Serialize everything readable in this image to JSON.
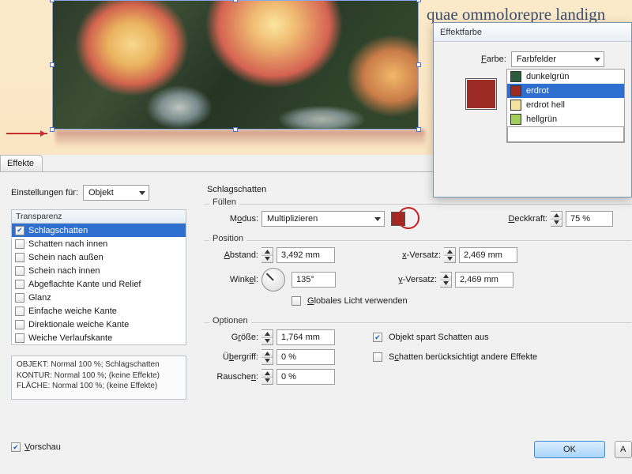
{
  "preview": {
    "bg_text_lines": [
      "quae ommolorepre landign"
    ]
  },
  "efx_panel": {
    "tab_label": "Effekte",
    "einstellungen_label": "Einstellungen für:",
    "einstellungen_value": "Objekt",
    "section_title": "Schlagschatten",
    "transparenz_header": "Transparenz",
    "effects": [
      {
        "label": "Schlagschatten",
        "checked": true,
        "selected": true
      },
      {
        "label": "Schatten nach innen",
        "checked": false
      },
      {
        "label": "Schein nach außen",
        "checked": false
      },
      {
        "label": "Schein nach innen",
        "checked": false
      },
      {
        "label": "Abgeflachte Kante und Relief",
        "checked": false
      },
      {
        "label": "Glanz",
        "checked": false
      },
      {
        "label": "Einfache weiche Kante",
        "checked": false
      },
      {
        "label": "Direktionale weiche Kante",
        "checked": false
      },
      {
        "label": "Weiche Verlaufskante",
        "checked": false
      }
    ],
    "status": [
      "OBJEKT: Normal 100 %; Schlagschatten",
      "KONTUR: Normal 100 %; (keine Effekte)",
      "FLÄCHE: Normal 100 %; (keine Effekte)"
    ],
    "vorschau_label": "Vorschau"
  },
  "fill": {
    "legend": "Füllen",
    "mode_label": "Modus:",
    "mode_value": "Multiplizieren",
    "swatch_color": "#9c2b25",
    "deckkraft_label": "Deckkraft:",
    "deckkraft_value": "75 %"
  },
  "position": {
    "legend": "Position",
    "abstand_label": "Abstand:",
    "abstand_value": "3,492 mm",
    "winkel_label": "Winkel:",
    "winkel_value": "135°",
    "xversatz_label": "x-Versatz:",
    "xversatz_value": "2,469 mm",
    "yversatz_label": "y-Versatz:",
    "yversatz_value": "2,469 mm",
    "global_light_label": "Globales Licht verwenden",
    "global_light_checked": false
  },
  "options": {
    "legend": "Optionen",
    "groesse_label": "Größe:",
    "groesse_value": "1,764 mm",
    "uebergriff_label": "Übergriff:",
    "uebergriff_value": "0 %",
    "rauschen_label": "Rauschen:",
    "rauschen_value": "0 %",
    "obj_spart_label": "Objekt spart Schatten aus",
    "obj_spart_checked": true,
    "schatten_andere_label": "Schatten berücksichtigt andere Effekte",
    "schatten_andere_checked": false
  },
  "buttons": {
    "ok": "OK",
    "a": "A"
  },
  "popup": {
    "title": "Effektfarbe",
    "farbe_label": "Farbe:",
    "farbe_value": "Farbfelder",
    "swatch_color": "#9c2b25",
    "colors": [
      {
        "name": "dunkelgrün",
        "hex": "#2b5d3c",
        "selected": false
      },
      {
        "name": "erdrot",
        "hex": "#9c2b25",
        "selected": true
      },
      {
        "name": "erdrot hell",
        "hex": "#f3e2a0",
        "selected": false
      },
      {
        "name": "hellgrün",
        "hex": "#9fcf5a",
        "selected": false
      }
    ]
  }
}
